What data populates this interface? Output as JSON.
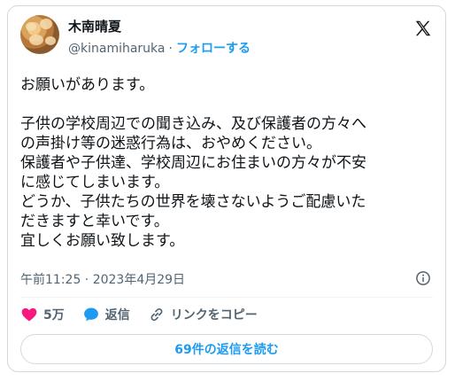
{
  "author": {
    "display_name": "木南晴夏",
    "handle": "@kinamiharuka",
    "separator": "·",
    "follow_label": "フォローする"
  },
  "logo": "x-logo-icon",
  "tweet": {
    "lines": [
      "お願いがあります。",
      "",
      "子供の学校周辺での聞き込み、及び保護者の方々へ",
      "の声掛け等の迷惑行為は、おやめください。",
      "保護者や子供達、学校周辺にお住まいの方々が不安",
      "に感じてしまいます。",
      "どうか、子供たちの世界を壊さないようご配慮いた",
      "だきますと幸いです。",
      "宜しくお願い致します。"
    ],
    "timestamp": "午前11:25 · 2023年4月29日"
  },
  "actions": {
    "like_count": "5万",
    "reply_label": "返信",
    "copy_link_label": "リンクをコピー"
  },
  "replies_button": "69件の返信を読む",
  "colors": {
    "accent": "#1d9bf0",
    "like": "#f91880",
    "muted": "#536471",
    "text": "#0f1419",
    "border": "#cfd9de"
  }
}
